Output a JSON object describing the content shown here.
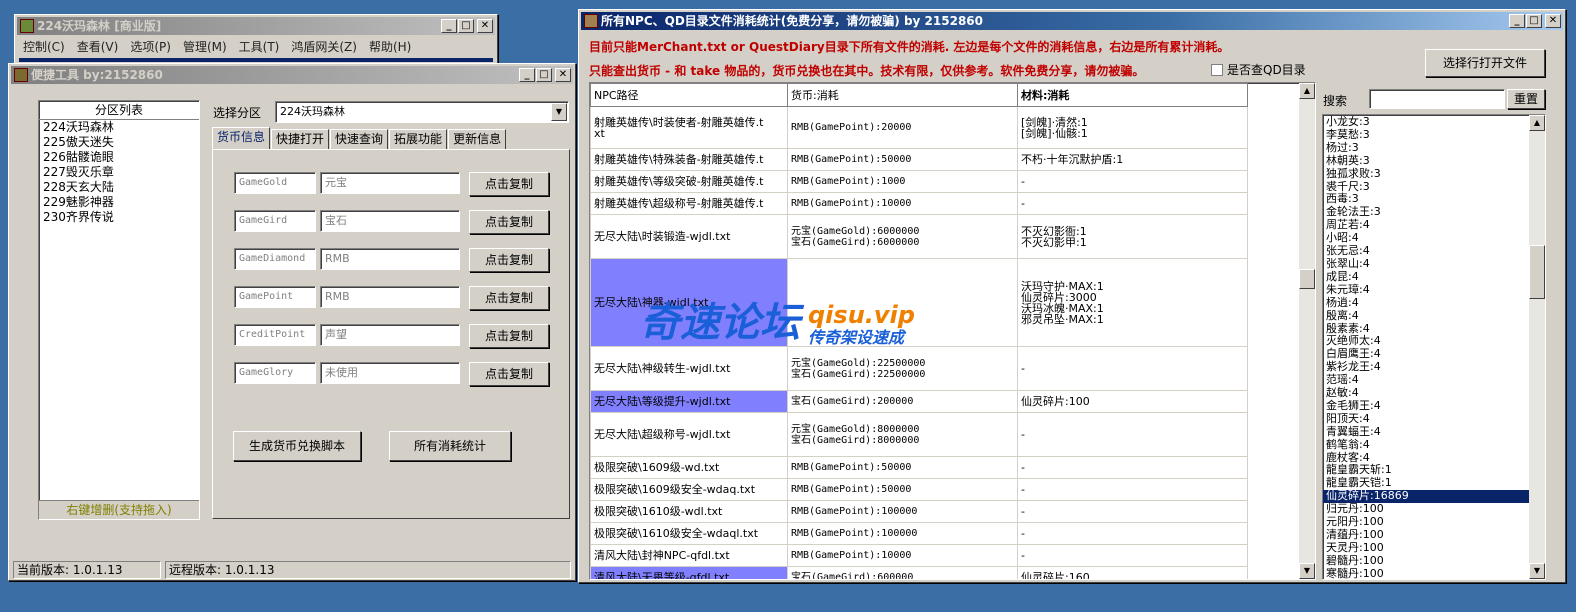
{
  "main_window": {
    "title": "224沃玛森林 [商业版]",
    "menu": [
      "控制(C)",
      "查看(V)",
      "选项(P)",
      "管理(M)",
      "工具(T)",
      "鸿盾网关(Z)",
      "帮助(H)"
    ]
  },
  "tool_window": {
    "title": "便捷工具  by:2152860",
    "partition_list_header": "分区列表",
    "partitions": [
      "224沃玛森林",
      "225傲天迷失",
      "226骷髅诡眼",
      "227毁灭乐章",
      "228天玄大陆",
      "229魅影神器",
      "230齐界传说"
    ],
    "list_footer": "右键增删(支持拖入)",
    "select_label": "选择分区",
    "select_value": "224沃玛森林",
    "tabs": [
      "货币信息",
      "快捷打开",
      "快速查询",
      "拓展功能",
      "更新信息"
    ],
    "currency_rows": [
      {
        "code": "GameGold",
        "name": "元宝",
        "button": "点击复制"
      },
      {
        "code": "GameGird",
        "name": "宝石",
        "button": "点击复制"
      },
      {
        "code": "GameDiamond",
        "name": "RMB",
        "button": "点击复制"
      },
      {
        "code": "GamePoint",
        "name": "RMB",
        "button": "点击复制"
      },
      {
        "code": "CreditPoint",
        "name": "声望",
        "button": "点击复制"
      },
      {
        "code": "GameGlory",
        "name": "未使用",
        "button": "点击复制"
      }
    ],
    "gen_button": "生成货币兑换脚本",
    "stats_button": "所有消耗统计",
    "status_current": "当前版本: 1.0.1.13",
    "status_remote": "远程版本: 1.0.1.13"
  },
  "stats_window": {
    "title": "所有NPC、QD目录文件消耗统计(免费分享，请勿被骗)      by 2152860",
    "note1": "目前只能MerChant.txt or QuestDiary目录下所有文件的消耗. 左边是每个文件的消耗信息，右边是所有累计消耗。",
    "note2": "只能查出货币 - 和 take 物品的，货币兑换也在其中。技术有限，仅供参考。软件免费分享，请勿被骗。",
    "qd_checkbox": "是否查QD目录",
    "open_file_button": "选择行打开文件",
    "search_label": "搜索",
    "reset_button": "重置",
    "headers": [
      "NPC路径",
      "货币:消耗",
      "材料:消耗"
    ],
    "rows": [
      {
        "path": "射雕英雄传\\时装使者-射雕英雄传.t\nxt",
        "currency": "RMB(GamePoint):20000",
        "material": "[剑魄]·清然:1\n[剑魄]·仙骸:1",
        "h": 42
      },
      {
        "path": "射雕英雄传\\特殊装备-射雕英雄传.t",
        "currency": "RMB(GamePoint):50000",
        "material": "不朽·十年沉默护盾:1",
        "h": 22
      },
      {
        "path": "射雕英雄传\\等级突破-射雕英雄传.t",
        "currency": "RMB(GamePoint):1000",
        "material": "-",
        "h": 22
      },
      {
        "path": "射雕英雄传\\超级称号-射雕英雄传.t",
        "currency": "RMB(GamePoint):10000",
        "material": "-",
        "h": 22
      },
      {
        "path": "无尽大陆\\时装锻造-wjdl.txt",
        "currency": "元宝(GameGold):6000000\n宝石(GameGird):6000000",
        "material": "不灭幻影衙:1\n不灭幻影甲:1",
        "h": 44
      },
      {
        "path": "无尽大陆\\神器-wjdl.txt",
        "currency": "",
        "material": "沃玛守护·MAX:1\n仙灵碎片:3000\n沃玛冰魄·MAX:1\n邪灵吊坠·MAX:1",
        "h": 88,
        "hl": true
      },
      {
        "path": "无尽大陆\\神级转生-wjdl.txt",
        "currency": "元宝(GameGold):22500000\n宝石(GameGird):22500000",
        "material": "-",
        "h": 44
      },
      {
        "path": "无尽大陆\\等级提升-wjdl.txt",
        "currency": "宝石(GameGird):200000",
        "material": "仙灵碎片:100",
        "h": 22,
        "hl": true
      },
      {
        "path": "无尽大陆\\超级称号-wjdl.txt",
        "currency": "元宝(GameGold):8000000\n宝石(GameGird):8000000",
        "material": "-",
        "h": 44
      },
      {
        "path": "极限突破\\1609级-wd.txt",
        "currency": "RMB(GamePoint):50000",
        "material": "-",
        "h": 22
      },
      {
        "path": "极限突破\\1609级安全-wdaq.txt",
        "currency": "RMB(GamePoint):50000",
        "material": "-",
        "h": 22
      },
      {
        "path": "极限突破\\1610级-wdl.txt",
        "currency": "RMB(GamePoint):100000",
        "material": "-",
        "h": 22
      },
      {
        "path": "极限突破\\1610级安全-wdaql.txt",
        "currency": "RMB(GamePoint):100000",
        "material": "-",
        "h": 22
      },
      {
        "path": "清风大陆\\封神NPC-qfdl.txt",
        "currency": "RMB(GamePoint):10000",
        "material": "-",
        "h": 22
      },
      {
        "path": "清风大陆\\无畏等级-qfdl.txt",
        "currency": "宝石(GameGird):600000",
        "material": "仙灵碎片:160",
        "h": 22,
        "hl": true
      }
    ],
    "totals": [
      "小龙女:3",
      "李莫愁:3",
      "杨过:3",
      "林朝英:3",
      "独孤求败:3",
      "裘千尺:3",
      "西毒:3",
      "金轮法王:3",
      "周芷若:4",
      "小昭:4",
      "张无忌:4",
      "张翠山:4",
      "成昆:4",
      "朱元璋:4",
      "杨逍:4",
      "殷离:4",
      "殷素素:4",
      "灭绝师太:4",
      "白眉鹰王:4",
      "紫衫龙王:4",
      "范瑶:4",
      "赵敏:4",
      "金毛狮王:4",
      "阳顶天:4",
      "青翼蝠王:4",
      "鹤笔翁:4",
      "鹿杖客:4",
      "龍皇霸天斩:1",
      "龍皇霸天铠:1",
      "仙灵碎片:16869",
      "归元丹:100",
      "元阳丹:100",
      "清蕴丹:100",
      "天灵丹:100",
      "碧髓丹:100",
      "寒髓丹:100"
    ],
    "selected_total": "仙灵碎片:16869"
  },
  "watermark": {
    "text": "奇速论坛",
    "domain": "qisu.vip",
    "slogan": "传奇架设速成"
  }
}
